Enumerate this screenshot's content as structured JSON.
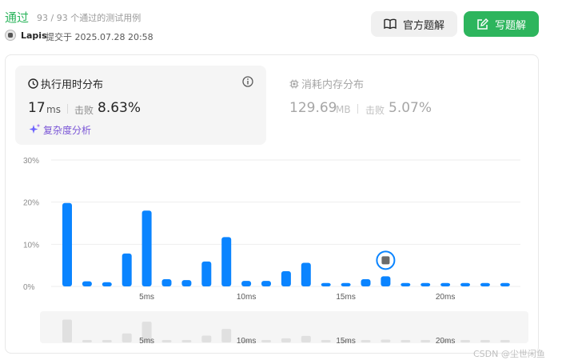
{
  "header": {
    "status": "通过",
    "pass_count": "93 / 93 个通过的测试用例",
    "author": "Lapis",
    "submitted": "提交于 2025.07.28 20:58",
    "official_solution_label": "官方题解",
    "write_solution_label": "写题解"
  },
  "runtime": {
    "title": "执行用时分布",
    "value": "17",
    "unit": "ms",
    "beats_label": "击败",
    "beats_value": "8.63%",
    "complexity_link": "复杂度分析"
  },
  "memory": {
    "title": "消耗内存分布",
    "value": "129.69",
    "unit": "MB",
    "beats_label": "击败",
    "beats_value": "5.07%"
  },
  "colors": {
    "accent_green": "#2db55d",
    "bar_blue": "#0a84ff",
    "complexity_purple": "#7a55d6"
  },
  "chart_data": {
    "type": "bar",
    "ylabel_ticks": [
      "0%",
      "10%",
      "20%",
      "30%"
    ],
    "ylim": [
      0,
      30
    ],
    "x_tick_labels": [
      "5ms",
      "10ms",
      "15ms",
      "20ms"
    ],
    "x_tick_values": [
      5,
      10,
      15,
      20
    ],
    "x": [
      1,
      2,
      3,
      4,
      5,
      6,
      7,
      8,
      9,
      10,
      11,
      12,
      13,
      14,
      15,
      16,
      17,
      18,
      19,
      20,
      21,
      22,
      23
    ],
    "values": [
      19.8,
      1.2,
      1.0,
      7.8,
      18.0,
      1.7,
      1.5,
      5.9,
      11.7,
      1.3,
      1.3,
      3.6,
      5.6,
      0.8,
      0.8,
      1.7,
      2.4,
      0.8,
      0.8,
      0.8,
      0.8,
      0.8,
      0.8
    ],
    "highlight_x": 17,
    "grid": true
  },
  "watermark": "CSDN @尘世闲鱼"
}
